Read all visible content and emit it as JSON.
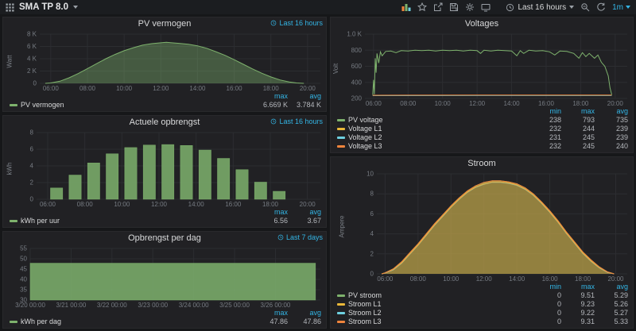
{
  "colors": {
    "accent_blue": "#33b5e5",
    "green": "#7EB26D",
    "yellow": "#EAB839",
    "light_blue": "#6ED0E0",
    "orange": "#EF843C",
    "panel_bg": "#212124",
    "page_bg": "#161719"
  },
  "navbar": {
    "title": "SMA TP 8.0",
    "icons": [
      "apps-menu",
      "add-panel",
      "star",
      "share",
      "save",
      "settings",
      "tv-mode",
      "clock",
      "zoom-out",
      "refresh"
    ],
    "time_picker": "Last 16 hours",
    "refresh_interval": "1m"
  },
  "panels": {
    "pv_vermogen": {
      "title": "PV vermogen",
      "badge": "Last 16 hours",
      "ylabel": "Watt",
      "legend": {
        "headers": [
          "max",
          "avg"
        ],
        "rows": [
          {
            "name": "PV vermogen",
            "color": "#7EB26D",
            "values": [
              "6.669 K",
              "3.784 K"
            ]
          }
        ]
      }
    },
    "voltages": {
      "title": "Voltages",
      "badge": "",
      "ylabel": "Volt",
      "legend": {
        "headers": [
          "min",
          "max",
          "avg"
        ],
        "rows": [
          {
            "name": "PV voltage",
            "color": "#7EB26D",
            "values": [
              "238",
              "793",
              "735"
            ]
          },
          {
            "name": "Voltage L1",
            "color": "#EAB839",
            "values": [
              "232",
              "244",
              "239"
            ]
          },
          {
            "name": "Voltage L2",
            "color": "#6ED0E0",
            "values": [
              "231",
              "245",
              "239"
            ]
          },
          {
            "name": "Voltage L3",
            "color": "#EF843C",
            "values": [
              "232",
              "245",
              "240"
            ]
          }
        ]
      }
    },
    "actuele_opbrengst": {
      "title": "Actuele opbrengst",
      "badge": "Last 16 hours",
      "ylabel": "kWh",
      "legend": {
        "headers": [
          "max",
          "avg"
        ],
        "rows": [
          {
            "name": "kWh per uur",
            "color": "#7EB26D",
            "values": [
              "6.56",
              "3.67"
            ]
          }
        ]
      }
    },
    "opbrengst_per_dag": {
      "title": "Opbrengst per dag",
      "badge": "Last 7 days",
      "ylabel": "",
      "legend": {
        "headers": [
          "max",
          "avg"
        ],
        "rows": [
          {
            "name": "kWh per dag",
            "color": "#7EB26D",
            "values": [
              "47.86",
              "47.86"
            ]
          }
        ]
      }
    },
    "stroom": {
      "title": "Stroom",
      "badge": "",
      "ylabel": "Ampere",
      "legend": {
        "headers": [
          "min",
          "max",
          "avg"
        ],
        "rows": [
          {
            "name": "PV stroom",
            "color": "#7EB26D",
            "values": [
              "0",
              "9.51",
              "5.29"
            ]
          },
          {
            "name": "Stroom L1",
            "color": "#EAB839",
            "values": [
              "0",
              "9.23",
              "5.26"
            ]
          },
          {
            "name": "Stroom L2",
            "color": "#6ED0E0",
            "values": [
              "0",
              "9.22",
              "5.27"
            ]
          },
          {
            "name": "Stroom L3",
            "color": "#EF843C",
            "values": [
              "0",
              "9.31",
              "5.33"
            ]
          }
        ]
      }
    }
  },
  "chart_data": [
    {
      "id": "pv-vermogen",
      "type": "area",
      "title": "PV vermogen",
      "ylabel": "Watt",
      "ml": 30,
      "xlim": [
        5.4,
        20.7
      ],
      "ylim": [
        0,
        8000
      ],
      "xticks": [
        {
          "v": 6,
          "l": "06:00"
        },
        {
          "v": 8,
          "l": "08:00"
        },
        {
          "v": 10,
          "l": "10:00"
        },
        {
          "v": 12,
          "l": "12:00"
        },
        {
          "v": 14,
          "l": "14:00"
        },
        {
          "v": 16,
          "l": "16:00"
        },
        {
          "v": 18,
          "l": "18:00"
        },
        {
          "v": 20,
          "l": "20:00"
        }
      ],
      "yticks": [
        {
          "v": 0,
          "l": "0"
        },
        {
          "v": 2000,
          "l": "2 K"
        },
        {
          "v": 4000,
          "l": "4 K"
        },
        {
          "v": 6000,
          "l": "6 K"
        },
        {
          "v": 8000,
          "l": "8 K"
        }
      ],
      "series": [
        {
          "name": "PV vermogen",
          "color": "#7EB26D",
          "fill": 0.4,
          "x": [
            5.7,
            6,
            6.5,
            7,
            7.5,
            8,
            8.5,
            9,
            9.5,
            10,
            10.5,
            11,
            11.5,
            12,
            12.3,
            12.6,
            13,
            13.5,
            14,
            14.5,
            15,
            15.5,
            16,
            16.5,
            17,
            17.5,
            18,
            18.5,
            19,
            19.4,
            19.8
          ],
          "y": [
            0,
            60,
            350,
            900,
            1600,
            2400,
            3200,
            4000,
            4700,
            5300,
            5800,
            6200,
            6450,
            6600,
            6669,
            6600,
            6500,
            6350,
            6100,
            5700,
            5150,
            4550,
            3850,
            3100,
            2350,
            1650,
            1050,
            550,
            230,
            70,
            0
          ]
        }
      ]
    },
    {
      "id": "voltages",
      "type": "area",
      "title": "Voltages",
      "ylabel": "Volt",
      "ml": 30,
      "xlim": [
        5.5,
        20.7
      ],
      "ylim": [
        200,
        1000
      ],
      "xticks": [
        {
          "v": 6,
          "l": "06:00"
        },
        {
          "v": 8,
          "l": "08:00"
        },
        {
          "v": 10,
          "l": "10:00"
        },
        {
          "v": 12,
          "l": "12:00"
        },
        {
          "v": 14,
          "l": "14:00"
        },
        {
          "v": 16,
          "l": "16:00"
        },
        {
          "v": 18,
          "l": "18:00"
        },
        {
          "v": 20,
          "l": "20:00"
        }
      ],
      "yticks": [
        {
          "v": 200,
          "l": "200"
        },
        {
          "v": 400,
          "l": "400"
        },
        {
          "v": 600,
          "l": "600"
        },
        {
          "v": 800,
          "l": "800"
        },
        {
          "v": 1000,
          "l": "1.0 K"
        }
      ],
      "series": [
        {
          "name": "Voltage L1",
          "color": "#EAB839",
          "fill": 0,
          "x": [
            5.95,
            12,
            19.8
          ],
          "y": [
            238,
            240,
            239
          ]
        },
        {
          "name": "Voltage L2",
          "color": "#6ED0E0",
          "fill": 0,
          "x": [
            5.95,
            12,
            19.8
          ],
          "y": [
            236,
            238,
            237
          ]
        },
        {
          "name": "Voltage L3",
          "color": "#EF843C",
          "fill": 0,
          "x": [
            5.95,
            12,
            19.8
          ],
          "y": [
            240,
            242,
            241
          ]
        },
        {
          "name": "PV voltage",
          "color": "#7EB26D",
          "fill": 0,
          "x": [
            5.95,
            6.0,
            6.05,
            6.1,
            6.15,
            6.2,
            6.3,
            6.4,
            6.5,
            6.7,
            7.0,
            7.3,
            7.6,
            8.0,
            8.4,
            8.8,
            9.2,
            9.6,
            10.0,
            10.4,
            10.8,
            11.2,
            11.6,
            12.0,
            12.2,
            12.4,
            12.8,
            13.2,
            13.6,
            14.0,
            14.3,
            14.5,
            14.7,
            15.0,
            15.4,
            15.8,
            16.2,
            16.5,
            16.8,
            17.2,
            17.6,
            17.9,
            18.1,
            18.3,
            18.5,
            18.8,
            19.0,
            19.2,
            19.4,
            19.6,
            19.7,
            19.8
          ],
          "y": [
            245,
            430,
            250,
            700,
            520,
            760,
            640,
            780,
            730,
            785,
            790,
            770,
            795,
            790,
            800,
            795,
            800,
            790,
            800,
            795,
            800,
            790,
            800,
            795,
            760,
            800,
            790,
            800,
            795,
            790,
            730,
            795,
            760,
            800,
            790,
            795,
            780,
            740,
            790,
            785,
            760,
            700,
            770,
            720,
            760,
            700,
            740,
            650,
            600,
            480,
            330,
            245
          ]
        }
      ]
    },
    {
      "id": "actuele-opbrengst",
      "type": "bars",
      "title": "Actuele opbrengst",
      "ylabel": "kWh",
      "ml": 26,
      "xlim": [
        5.4,
        20.7
      ],
      "ylim": [
        0,
        8
      ],
      "bar_width": 0.7,
      "xticks": [
        {
          "v": 6,
          "l": "06:00"
        },
        {
          "v": 8,
          "l": "08:00"
        },
        {
          "v": 10,
          "l": "10:00"
        },
        {
          "v": 12,
          "l": "12:00"
        },
        {
          "v": 14,
          "l": "14:00"
        },
        {
          "v": 16,
          "l": "16:00"
        },
        {
          "v": 18,
          "l": "18:00"
        },
        {
          "v": 20,
          "l": "20:00"
        }
      ],
      "yticks": [
        {
          "v": 0,
          "l": "0"
        },
        {
          "v": 2,
          "l": "2"
        },
        {
          "v": 4,
          "l": "4"
        },
        {
          "v": 6,
          "l": "6"
        },
        {
          "v": 8,
          "l": "8"
        }
      ],
      "series": [
        {
          "name": "kWh per uur",
          "color": "#7EB26D",
          "fill": 0.85,
          "x": [
            6.5,
            7.5,
            8.5,
            9.5,
            10.5,
            11.5,
            12.5,
            13.5,
            14.5,
            15.5,
            16.5,
            17.5,
            18.5
          ],
          "y": [
            1.35,
            2.9,
            4.35,
            5.45,
            6.2,
            6.5,
            6.56,
            6.45,
            5.9,
            4.9,
            3.55,
            2.05,
            0.95
          ]
        }
      ]
    },
    {
      "id": "opbrengst-per-dag",
      "type": "bars",
      "title": "Opbrengst per dag",
      "ylabel": "",
      "ml": 22,
      "xlim": [
        0,
        7.1
      ],
      "ylim": [
        30,
        55
      ],
      "bar_width": 7.0,
      "xticks": [
        {
          "v": 0,
          "l": "3/20 00:00"
        },
        {
          "v": 1,
          "l": "3/21 00:00"
        },
        {
          "v": 2,
          "l": "3/22 00:00"
        },
        {
          "v": 3,
          "l": "3/23 00:00"
        },
        {
          "v": 4,
          "l": "3/24 00:00"
        },
        {
          "v": 5,
          "l": "3/25 00:00"
        },
        {
          "v": 6,
          "l": "3/26 00:00"
        }
      ],
      "yticks": [
        {
          "v": 30,
          "l": "30"
        },
        {
          "v": 35,
          "l": "35"
        },
        {
          "v": 40,
          "l": "40"
        },
        {
          "v": 45,
          "l": "45"
        },
        {
          "v": 50,
          "l": "50"
        },
        {
          "v": 55,
          "l": "55"
        }
      ],
      "series": [
        {
          "name": "kWh per dag",
          "color": "#7EB26D",
          "fill": 0.85,
          "x": [
            3.5
          ],
          "y": [
            47.86
          ]
        }
      ]
    },
    {
      "id": "stroom",
      "type": "area",
      "title": "Stroom",
      "ylabel": "Ampere",
      "ml": 30,
      "xlim": [
        5.5,
        20.7
      ],
      "ylim": [
        0,
        10
      ],
      "xticks": [
        {
          "v": 6,
          "l": "06:00"
        },
        {
          "v": 8,
          "l": "08:00"
        },
        {
          "v": 10,
          "l": "10:00"
        },
        {
          "v": 12,
          "l": "12:00"
        },
        {
          "v": 14,
          "l": "14:00"
        },
        {
          "v": 16,
          "l": "16:00"
        },
        {
          "v": 18,
          "l": "18:00"
        },
        {
          "v": 20,
          "l": "20:00"
        }
      ],
      "yticks": [
        {
          "v": 0,
          "l": "0"
        },
        {
          "v": 2,
          "l": "2"
        },
        {
          "v": 4,
          "l": "4"
        },
        {
          "v": 6,
          "l": "6"
        },
        {
          "v": 8,
          "l": "8"
        },
        {
          "v": 10,
          "l": "10"
        }
      ],
      "series": [
        {
          "name": "PV stroom",
          "color": "#7EB26D",
          "fill": 0.45,
          "x": [
            5.8,
            6,
            6.5,
            7,
            7.5,
            8,
            8.5,
            9,
            9.5,
            10,
            10.5,
            11,
            11.5,
            12,
            12.5,
            13,
            13.5,
            14,
            14.5,
            15,
            15.5,
            16,
            16.5,
            17,
            17.5,
            18,
            18.5,
            19,
            19.5,
            19.9
          ],
          "y": [
            0,
            0.1,
            0.5,
            1.2,
            2.1,
            3.0,
            4.0,
            5.0,
            5.9,
            6.8,
            7.6,
            8.3,
            8.8,
            9.1,
            9.3,
            9.3,
            9.2,
            9.0,
            8.6,
            8.0,
            7.2,
            6.3,
            5.3,
            4.2,
            3.2,
            2.2,
            1.4,
            0.7,
            0.2,
            0
          ]
        },
        {
          "name": "Stroom L2",
          "color": "#6ED0E0",
          "fill": 0,
          "x": [
            5.8,
            6,
            6.5,
            7,
            7.5,
            8,
            8.5,
            9,
            9.5,
            10,
            10.5,
            11,
            11.5,
            12,
            12.5,
            13,
            13.5,
            14,
            14.5,
            15,
            15.5,
            16,
            16.5,
            17,
            17.5,
            18,
            18.5,
            19,
            19.5,
            19.9
          ],
          "y": [
            0,
            0.08,
            0.4,
            1.05,
            1.95,
            2.85,
            3.85,
            4.85,
            5.75,
            6.65,
            7.45,
            8.15,
            8.65,
            8.95,
            9.15,
            9.15,
            9.05,
            8.85,
            8.45,
            7.85,
            7.05,
            6.15,
            5.15,
            4.05,
            3.05,
            2.05,
            1.25,
            0.6,
            0.15,
            0
          ]
        },
        {
          "name": "Stroom L1",
          "color": "#EAB839",
          "fill": 0.35,
          "x": [
            5.8,
            6,
            6.5,
            7,
            7.5,
            8,
            8.5,
            9,
            9.5,
            10,
            10.5,
            11,
            11.5,
            12,
            12.5,
            13,
            13.5,
            14,
            14.5,
            15,
            15.5,
            16,
            16.5,
            17,
            17.5,
            18,
            18.5,
            19,
            19.5,
            19.9
          ],
          "y": [
            0,
            0.1,
            0.45,
            1.1,
            2.0,
            2.9,
            3.9,
            4.9,
            5.8,
            6.7,
            7.5,
            8.2,
            8.7,
            9.0,
            9.2,
            9.2,
            9.1,
            8.9,
            8.5,
            7.9,
            7.1,
            6.2,
            5.2,
            4.1,
            3.1,
            2.1,
            1.3,
            0.65,
            0.18,
            0
          ]
        },
        {
          "name": "Stroom L3",
          "color": "#EF843C",
          "fill": 0.15,
          "x": [
            5.8,
            6,
            6.5,
            7,
            7.5,
            8,
            8.5,
            9,
            9.5,
            10,
            10.5,
            11,
            11.5,
            12,
            12.5,
            13,
            13.5,
            14,
            14.5,
            15,
            15.5,
            16,
            16.5,
            17,
            17.5,
            18,
            18.5,
            19,
            19.5,
            19.9
          ],
          "y": [
            0,
            0.1,
            0.5,
            1.2,
            2.1,
            3.0,
            4.0,
            5.0,
            5.9,
            6.8,
            7.6,
            8.3,
            8.8,
            9.15,
            9.31,
            9.31,
            9.2,
            9.0,
            8.6,
            8.0,
            7.2,
            6.3,
            5.3,
            4.2,
            3.2,
            2.2,
            1.4,
            0.7,
            0.2,
            0
          ]
        }
      ]
    }
  ]
}
